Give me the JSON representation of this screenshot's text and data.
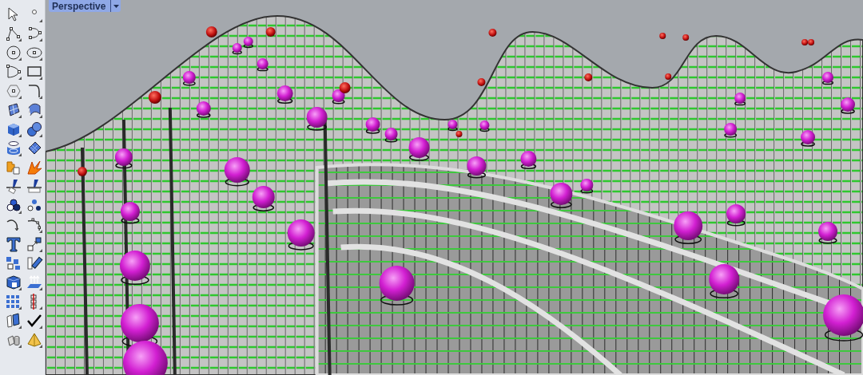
{
  "viewport": {
    "title": "Perspective"
  }
}
